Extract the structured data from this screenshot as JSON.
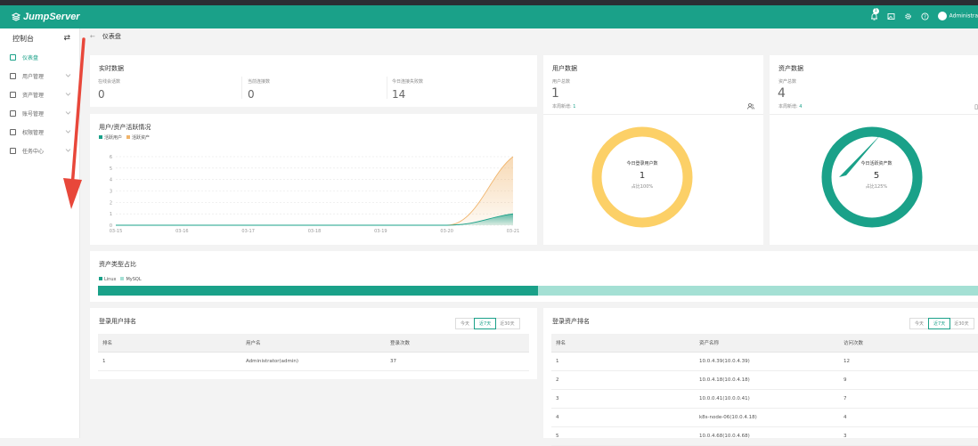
{
  "topbar": {
    "brand": "JumpServer",
    "notif_count": "1",
    "user": "Administra"
  },
  "sidebar": {
    "title": "控制台",
    "items": [
      {
        "label": "仪表盘",
        "active": true
      },
      {
        "label": "用户管理"
      },
      {
        "label": "资产管理"
      },
      {
        "label": "账号管理"
      },
      {
        "label": "权限管理"
      },
      {
        "label": "任务中心"
      }
    ]
  },
  "breadcrumb": "仪表盘",
  "realtime": {
    "title": "实时数据",
    "stats": [
      {
        "label": "在线会话数",
        "value": "0"
      },
      {
        "label": "当前连接数",
        "value": "0"
      },
      {
        "label": "今日连接失败数",
        "value": "14"
      }
    ]
  },
  "userdata": {
    "title": "用户数据",
    "label": "用户总数",
    "value": "1",
    "week_label": "本周新增:",
    "week_value": "1",
    "ring_label": "今日登录用户数",
    "ring_value": "1",
    "ring_pct": "占比100%"
  },
  "assetdata": {
    "title": "资产数据",
    "label": "资产总数",
    "value": "4",
    "week_label": "本周新增:",
    "week_value": "4",
    "ring_label": "今日活跃资产数",
    "ring_value": "5",
    "ring_pct": "占比125%"
  },
  "activity": {
    "title": "用户/资产活跃情况"
  },
  "chart_data": [
    {
      "type": "area",
      "title": "用户/资产活跃情况",
      "categories": [
        "03-15",
        "03-16",
        "03-17",
        "03-18",
        "03-19",
        "03-20",
        "03-21"
      ],
      "ylim": [
        0,
        6
      ],
      "yticks": [
        "0",
        "1",
        "2",
        "3",
        "4",
        "5",
        "6"
      ],
      "series": [
        {
          "name": "活跃用户",
          "values": [
            0,
            0,
            0,
            0,
            0,
            0,
            1
          ],
          "color": "#1aa189"
        },
        {
          "name": "活跃资产",
          "values": [
            0,
            0,
            0,
            0,
            0,
            0,
            6
          ],
          "color": "#f0b46b"
        }
      ],
      "legend": "top-left"
    },
    {
      "type": "bar",
      "title": "资产类型占比",
      "series": [
        {
          "name": "Linux",
          "values": [
            0.5
          ],
          "color": "#1aa189"
        },
        {
          "name": "MySQL",
          "values": [
            0.5
          ],
          "color": "#a4e0d4"
        }
      ],
      "legend": "top-left"
    }
  ],
  "tabs": [
    "今天",
    "近7天",
    "近30天"
  ],
  "user_rank": {
    "title": "登录用户排名",
    "headers": [
      "排名",
      "用户名",
      "登录次数"
    ],
    "rows": [
      [
        "1",
        "Administrator(admin)",
        "37"
      ]
    ]
  },
  "asset_rank": {
    "title": "登录资产排名",
    "headers": [
      "排名",
      "资产名称",
      "访问次数"
    ],
    "rows": [
      [
        "1",
        "10.0.4.39(10.0.4.39)",
        "12"
      ],
      [
        "2",
        "10.0.4.18(10.0.4.18)",
        "9"
      ],
      [
        "3",
        "10.0.0.41(10.0.0.41)",
        "7"
      ],
      [
        "4",
        "k8s-node-06(10.0.4.18)",
        "4"
      ],
      [
        "5",
        "10.0.4.68(10.0.4.68)",
        "3"
      ]
    ]
  },
  "colors": {
    "primary": "#1aa189",
    "ring_user": "#fcd067",
    "ring_asset": "#1aa189",
    "assets_area": "#f0b46b",
    "annotation_arrow": "#e8473a"
  }
}
